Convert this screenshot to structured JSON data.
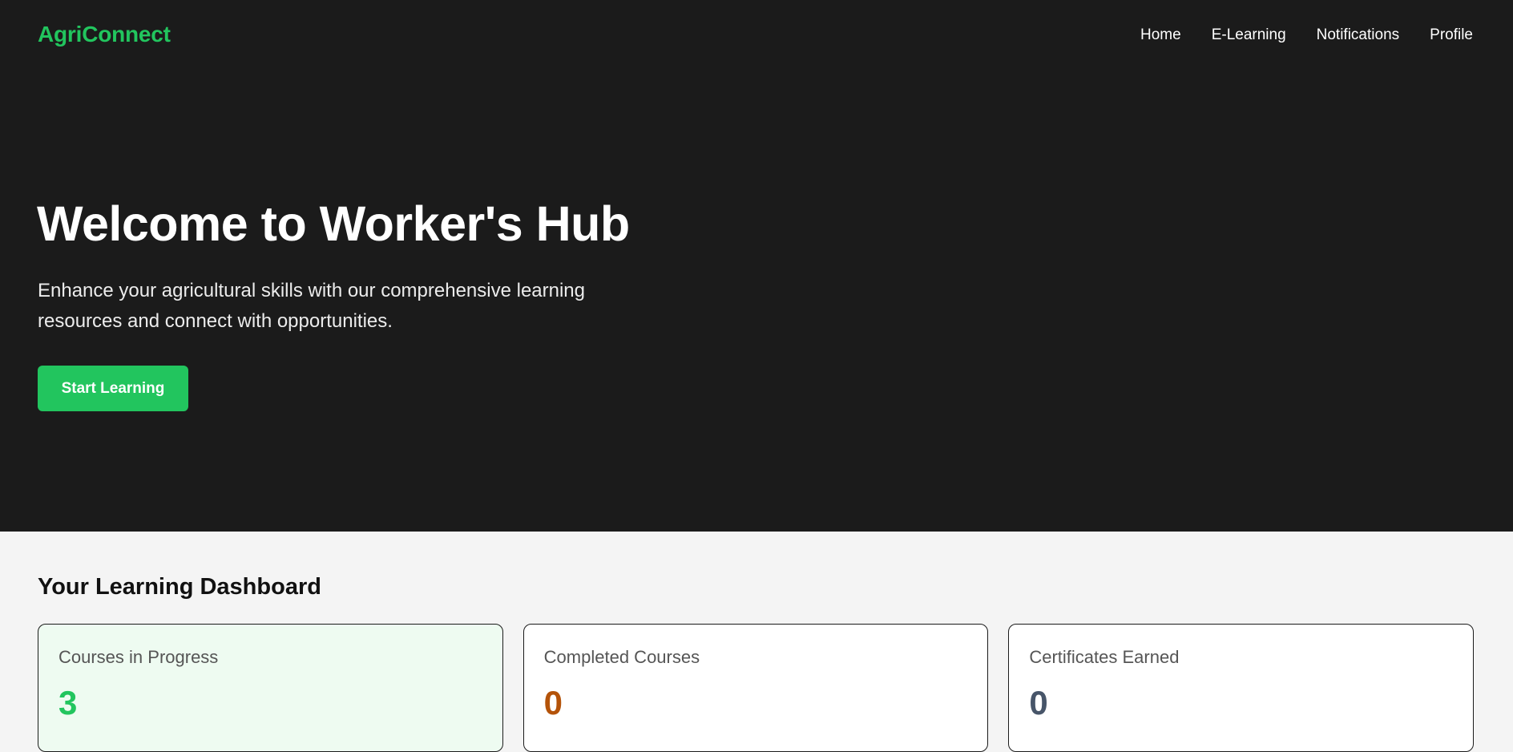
{
  "brand": {
    "name": "AgriConnect",
    "color": "#22c55e"
  },
  "nav": {
    "items": [
      {
        "label": "Home"
      },
      {
        "label": "E-Learning"
      },
      {
        "label": "Notifications"
      },
      {
        "label": "Profile"
      }
    ]
  },
  "hero": {
    "title": "Welcome to Worker's Hub",
    "subtitle": "Enhance your agricultural skills with our comprehensive learning resources and connect with opportunities.",
    "cta_label": "Start Learning"
  },
  "dashboard": {
    "title": "Your Learning Dashboard",
    "cards": [
      {
        "label": "Courses in Progress",
        "value": "3",
        "value_color": "#22c55e"
      },
      {
        "label": "Completed Courses",
        "value": "0",
        "value_color": "#b45309"
      },
      {
        "label": "Certificates Earned",
        "value": "0",
        "value_color": "#475569"
      }
    ]
  }
}
